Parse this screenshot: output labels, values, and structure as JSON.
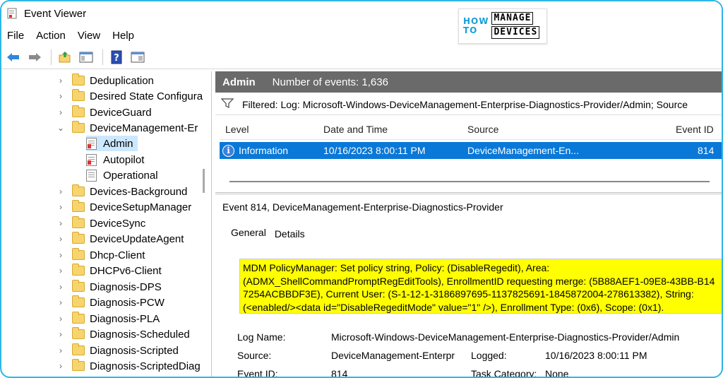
{
  "window": {
    "title": "Event Viewer"
  },
  "logo": {
    "line1": "HOW",
    "line2": "TO",
    "box1": "MANAGE",
    "box2": "DEVICES"
  },
  "menu": [
    "File",
    "Action",
    "View",
    "Help"
  ],
  "tree": {
    "items": [
      {
        "label": "Deduplication",
        "expanded": false
      },
      {
        "label": "Desired State Configura",
        "expanded": false
      },
      {
        "label": "DeviceGuard",
        "expanded": false
      },
      {
        "label": "DeviceManagement-Er",
        "expanded": true
      },
      {
        "label": "Admin",
        "child": true,
        "selected": true
      },
      {
        "label": "Autopilot",
        "child": true
      },
      {
        "label": "Operational",
        "child": true
      },
      {
        "label": "Devices-Background",
        "expanded": false
      },
      {
        "label": "DeviceSetupManager",
        "expanded": false
      },
      {
        "label": "DeviceSync",
        "expanded": false
      },
      {
        "label": "DeviceUpdateAgent",
        "expanded": false
      },
      {
        "label": "Dhcp-Client",
        "expanded": false
      },
      {
        "label": "DHCPv6-Client",
        "expanded": false
      },
      {
        "label": "Diagnosis-DPS",
        "expanded": false
      },
      {
        "label": "Diagnosis-PCW",
        "expanded": false
      },
      {
        "label": "Diagnosis-PLA",
        "expanded": false
      },
      {
        "label": "Diagnosis-Scheduled",
        "expanded": false
      },
      {
        "label": "Diagnosis-Scripted",
        "expanded": false
      },
      {
        "label": "Diagnosis-ScriptedDiag",
        "expanded": false
      }
    ]
  },
  "log_header": {
    "name": "Admin",
    "count_text": "Number of events: 1,636"
  },
  "filter": {
    "text": "Filtered: Log: Microsoft-Windows-DeviceManagement-Enterprise-Diagnostics-Provider/Admin; Source"
  },
  "events_table": {
    "columns": {
      "level": "Level",
      "date": "Date and Time",
      "source": "Source",
      "event_id": "Event ID"
    },
    "rows": [
      {
        "level": "Information",
        "date": "10/16/2023 8:00:11 PM",
        "source": "DeviceManagement-En...",
        "event_id": "814"
      }
    ]
  },
  "detail": {
    "title": "Event 814, DeviceManagement-Enterprise-Diagnostics-Provider",
    "tabs": [
      "General",
      "Details"
    ],
    "message_lines": [
      "MDM PolicyManager: Set policy string, Policy: (DisableRegedit), Area:",
      "(ADMX_ShellCommandPromptRegEditTools), EnrollmentID requesting merge: (5B88AEF1-09E8-43BB-B14",
      "7254ACBBDF3E), Current User: (S-1-12-1-3186897695-1137825691-1845872004-278613382), String:",
      "(<enabled/><data id=\"DisableRegeditMode\" value=\"1\" />), Enrollment Type: (0x6), Scope: (0x1)."
    ],
    "fields": {
      "log_name_label": "Log Name:",
      "log_name_value": "Microsoft-Windows-DeviceManagement-Enterprise-Diagnostics-Provider/Admin",
      "source_label": "Source:",
      "source_value": "DeviceManagement-Enterpr",
      "logged_label": "Logged:",
      "logged_value": "10/16/2023 8:00:11 PM",
      "event_id_label": "Event ID:",
      "event_id_value": "814",
      "task_category_label": "Task Category:",
      "task_category_value": "None"
    }
  },
  "colors": {
    "accent_border": "#2fb7e6",
    "selection": "#0a78d7",
    "header_strip": "#6a6a6a",
    "highlight": "#ffff00"
  }
}
